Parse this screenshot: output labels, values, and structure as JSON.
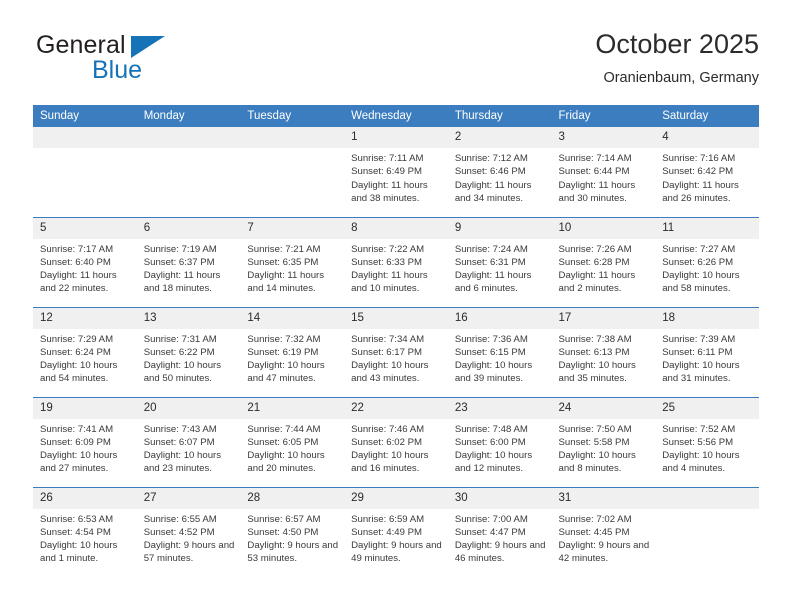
{
  "brand": {
    "name_part1": "General",
    "name_part2": "Blue",
    "triangle_color": "#1673b8"
  },
  "header": {
    "title": "October 2025",
    "subtitle": "Oranienbaum, Germany",
    "accent_color": "#3b7dbf",
    "daystrip_color": "#f0f0f0"
  },
  "weekdays": [
    "Sunday",
    "Monday",
    "Tuesday",
    "Wednesday",
    "Thursday",
    "Friday",
    "Saturday"
  ],
  "labels": {
    "sunrise": "Sunrise:",
    "sunset": "Sunset:",
    "daylight": "Daylight:"
  },
  "weeks": [
    [
      {
        "day": "",
        "sunrise": "",
        "sunset": "",
        "daylight": "",
        "empty": true
      },
      {
        "day": "",
        "sunrise": "",
        "sunset": "",
        "daylight": "",
        "empty": true
      },
      {
        "day": "",
        "sunrise": "",
        "sunset": "",
        "daylight": "",
        "empty": true
      },
      {
        "day": "1",
        "sunrise": "Sunrise: 7:11 AM",
        "sunset": "Sunset: 6:49 PM",
        "daylight": "Daylight: 11 hours and 38 minutes."
      },
      {
        "day": "2",
        "sunrise": "Sunrise: 7:12 AM",
        "sunset": "Sunset: 6:46 PM",
        "daylight": "Daylight: 11 hours and 34 minutes."
      },
      {
        "day": "3",
        "sunrise": "Sunrise: 7:14 AM",
        "sunset": "Sunset: 6:44 PM",
        "daylight": "Daylight: 11 hours and 30 minutes."
      },
      {
        "day": "4",
        "sunrise": "Sunrise: 7:16 AM",
        "sunset": "Sunset: 6:42 PM",
        "daylight": "Daylight: 11 hours and 26 minutes."
      }
    ],
    [
      {
        "day": "5",
        "sunrise": "Sunrise: 7:17 AM",
        "sunset": "Sunset: 6:40 PM",
        "daylight": "Daylight: 11 hours and 22 minutes."
      },
      {
        "day": "6",
        "sunrise": "Sunrise: 7:19 AM",
        "sunset": "Sunset: 6:37 PM",
        "daylight": "Daylight: 11 hours and 18 minutes."
      },
      {
        "day": "7",
        "sunrise": "Sunrise: 7:21 AM",
        "sunset": "Sunset: 6:35 PM",
        "daylight": "Daylight: 11 hours and 14 minutes."
      },
      {
        "day": "8",
        "sunrise": "Sunrise: 7:22 AM",
        "sunset": "Sunset: 6:33 PM",
        "daylight": "Daylight: 11 hours and 10 minutes."
      },
      {
        "day": "9",
        "sunrise": "Sunrise: 7:24 AM",
        "sunset": "Sunset: 6:31 PM",
        "daylight": "Daylight: 11 hours and 6 minutes."
      },
      {
        "day": "10",
        "sunrise": "Sunrise: 7:26 AM",
        "sunset": "Sunset: 6:28 PM",
        "daylight": "Daylight: 11 hours and 2 minutes."
      },
      {
        "day": "11",
        "sunrise": "Sunrise: 7:27 AM",
        "sunset": "Sunset: 6:26 PM",
        "daylight": "Daylight: 10 hours and 58 minutes."
      }
    ],
    [
      {
        "day": "12",
        "sunrise": "Sunrise: 7:29 AM",
        "sunset": "Sunset: 6:24 PM",
        "daylight": "Daylight: 10 hours and 54 minutes."
      },
      {
        "day": "13",
        "sunrise": "Sunrise: 7:31 AM",
        "sunset": "Sunset: 6:22 PM",
        "daylight": "Daylight: 10 hours and 50 minutes."
      },
      {
        "day": "14",
        "sunrise": "Sunrise: 7:32 AM",
        "sunset": "Sunset: 6:19 PM",
        "daylight": "Daylight: 10 hours and 47 minutes."
      },
      {
        "day": "15",
        "sunrise": "Sunrise: 7:34 AM",
        "sunset": "Sunset: 6:17 PM",
        "daylight": "Daylight: 10 hours and 43 minutes."
      },
      {
        "day": "16",
        "sunrise": "Sunrise: 7:36 AM",
        "sunset": "Sunset: 6:15 PM",
        "daylight": "Daylight: 10 hours and 39 minutes."
      },
      {
        "day": "17",
        "sunrise": "Sunrise: 7:38 AM",
        "sunset": "Sunset: 6:13 PM",
        "daylight": "Daylight: 10 hours and 35 minutes."
      },
      {
        "day": "18",
        "sunrise": "Sunrise: 7:39 AM",
        "sunset": "Sunset: 6:11 PM",
        "daylight": "Daylight: 10 hours and 31 minutes."
      }
    ],
    [
      {
        "day": "19",
        "sunrise": "Sunrise: 7:41 AM",
        "sunset": "Sunset: 6:09 PM",
        "daylight": "Daylight: 10 hours and 27 minutes."
      },
      {
        "day": "20",
        "sunrise": "Sunrise: 7:43 AM",
        "sunset": "Sunset: 6:07 PM",
        "daylight": "Daylight: 10 hours and 23 minutes."
      },
      {
        "day": "21",
        "sunrise": "Sunrise: 7:44 AM",
        "sunset": "Sunset: 6:05 PM",
        "daylight": "Daylight: 10 hours and 20 minutes."
      },
      {
        "day": "22",
        "sunrise": "Sunrise: 7:46 AM",
        "sunset": "Sunset: 6:02 PM",
        "daylight": "Daylight: 10 hours and 16 minutes."
      },
      {
        "day": "23",
        "sunrise": "Sunrise: 7:48 AM",
        "sunset": "Sunset: 6:00 PM",
        "daylight": "Daylight: 10 hours and 12 minutes."
      },
      {
        "day": "24",
        "sunrise": "Sunrise: 7:50 AM",
        "sunset": "Sunset: 5:58 PM",
        "daylight": "Daylight: 10 hours and 8 minutes."
      },
      {
        "day": "25",
        "sunrise": "Sunrise: 7:52 AM",
        "sunset": "Sunset: 5:56 PM",
        "daylight": "Daylight: 10 hours and 4 minutes."
      }
    ],
    [
      {
        "day": "26",
        "sunrise": "Sunrise: 6:53 AM",
        "sunset": "Sunset: 4:54 PM",
        "daylight": "Daylight: 10 hours and 1 minute."
      },
      {
        "day": "27",
        "sunrise": "Sunrise: 6:55 AM",
        "sunset": "Sunset: 4:52 PM",
        "daylight": "Daylight: 9 hours and 57 minutes."
      },
      {
        "day": "28",
        "sunrise": "Sunrise: 6:57 AM",
        "sunset": "Sunset: 4:50 PM",
        "daylight": "Daylight: 9 hours and 53 minutes."
      },
      {
        "day": "29",
        "sunrise": "Sunrise: 6:59 AM",
        "sunset": "Sunset: 4:49 PM",
        "daylight": "Daylight: 9 hours and 49 minutes."
      },
      {
        "day": "30",
        "sunrise": "Sunrise: 7:00 AM",
        "sunset": "Sunset: 4:47 PM",
        "daylight": "Daylight: 9 hours and 46 minutes."
      },
      {
        "day": "31",
        "sunrise": "Sunrise: 7:02 AM",
        "sunset": "Sunset: 4:45 PM",
        "daylight": "Daylight: 9 hours and 42 minutes."
      },
      {
        "day": "",
        "sunrise": "",
        "sunset": "",
        "daylight": "",
        "empty": true
      }
    ]
  ]
}
